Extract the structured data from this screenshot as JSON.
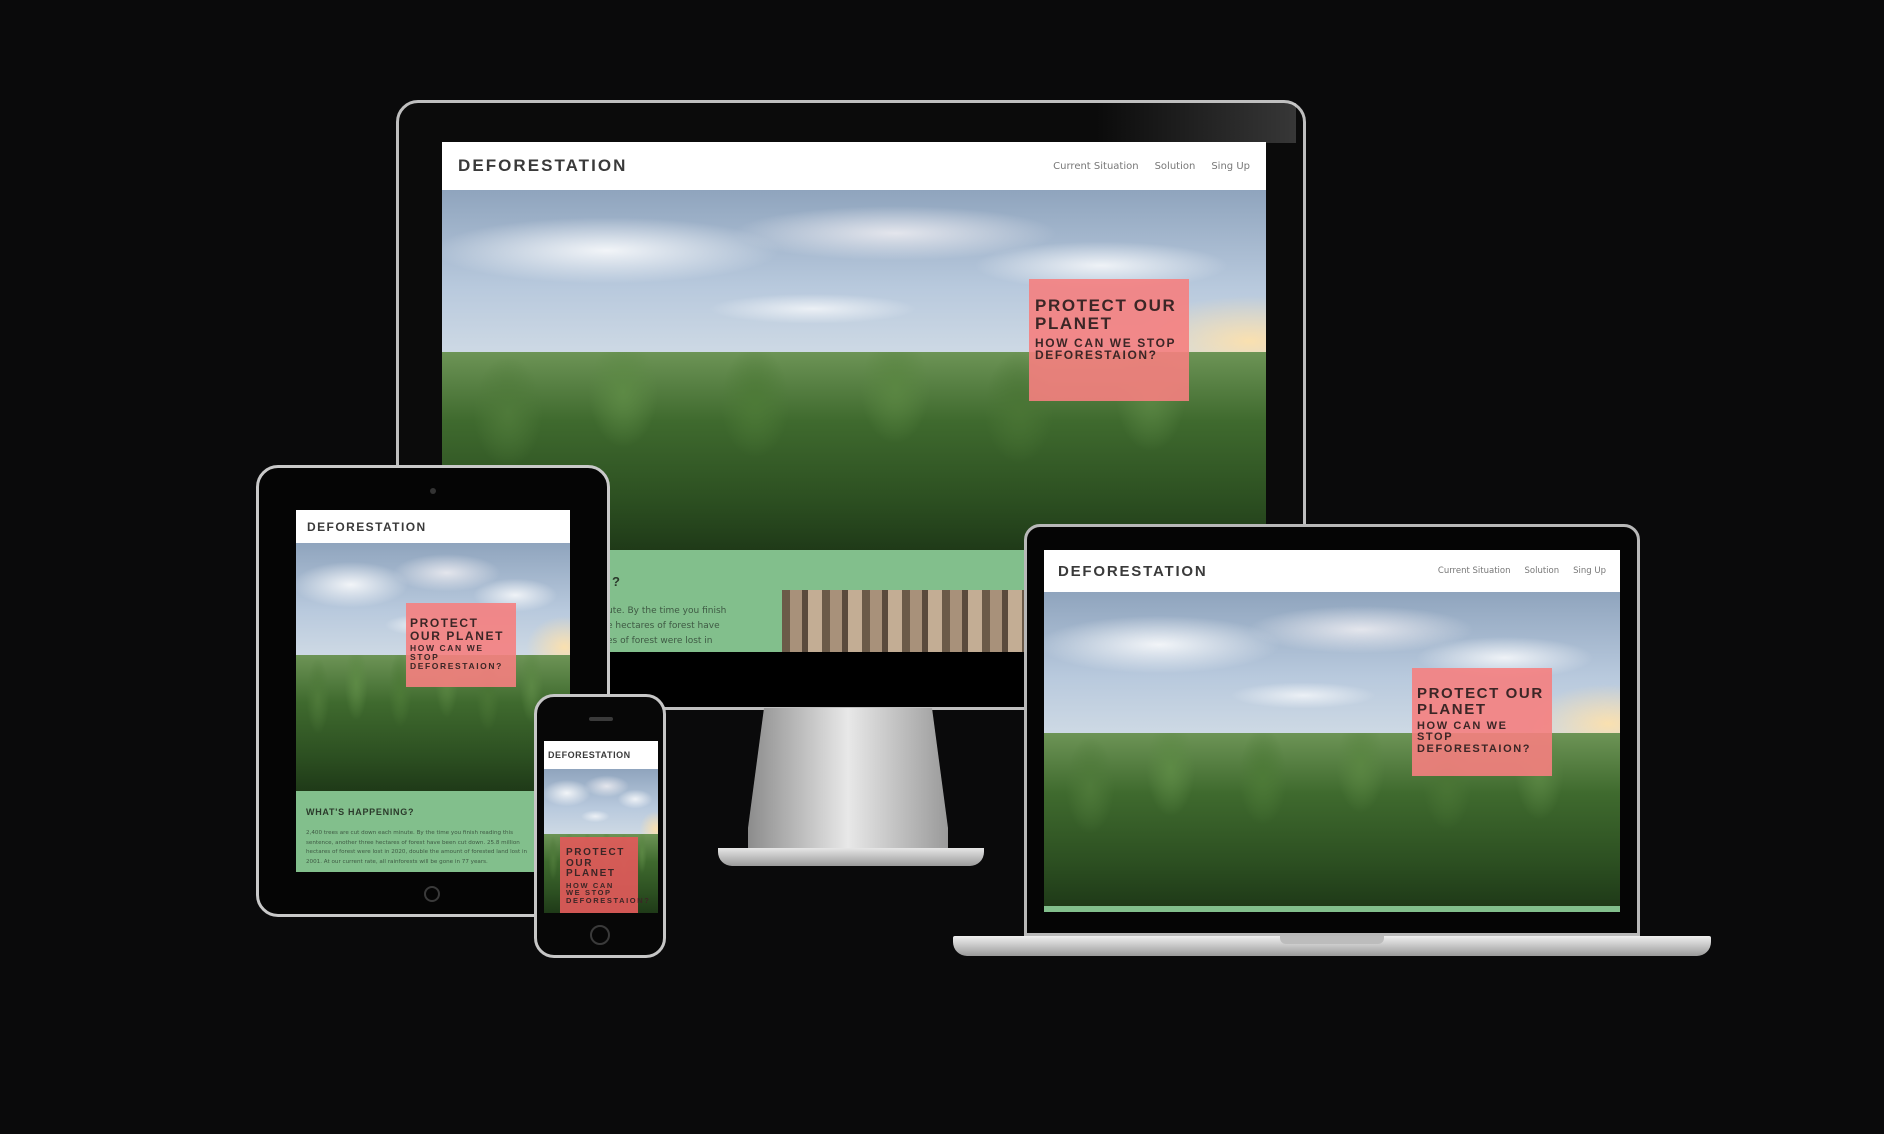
{
  "site": {
    "logo": "DEFORESTATION",
    "nav": [
      "Current Situation",
      "Solution",
      "Sing Up"
    ],
    "hero_title": "PROTECT OUR PLANET",
    "hero_subtitle": "HOW CAN WE STOP DEFORESTAION?",
    "section_heading": "WHAT'S HAPPENING?",
    "section_heading_partial": "?",
    "section_text": "2,400 trees are cut down each minute. By the time you finish reading this sentence, another three hectares of forest have been cut down. 25.8 million hectares of forest were lost in 2020, double the amount of forested land lost in 2001. At our current rate, all rainforests will be gone in 77 years.",
    "section_text_partial": [
      "ute. By the time you finish",
      "e hectares of forest have",
      "es of forest were lost in"
    ]
  },
  "colors": {
    "background": "#0a0a0b",
    "cta": "#f58080",
    "section_green": "#82bf8c"
  },
  "devices": [
    "desktop-monitor",
    "laptop",
    "tablet",
    "phone"
  ]
}
